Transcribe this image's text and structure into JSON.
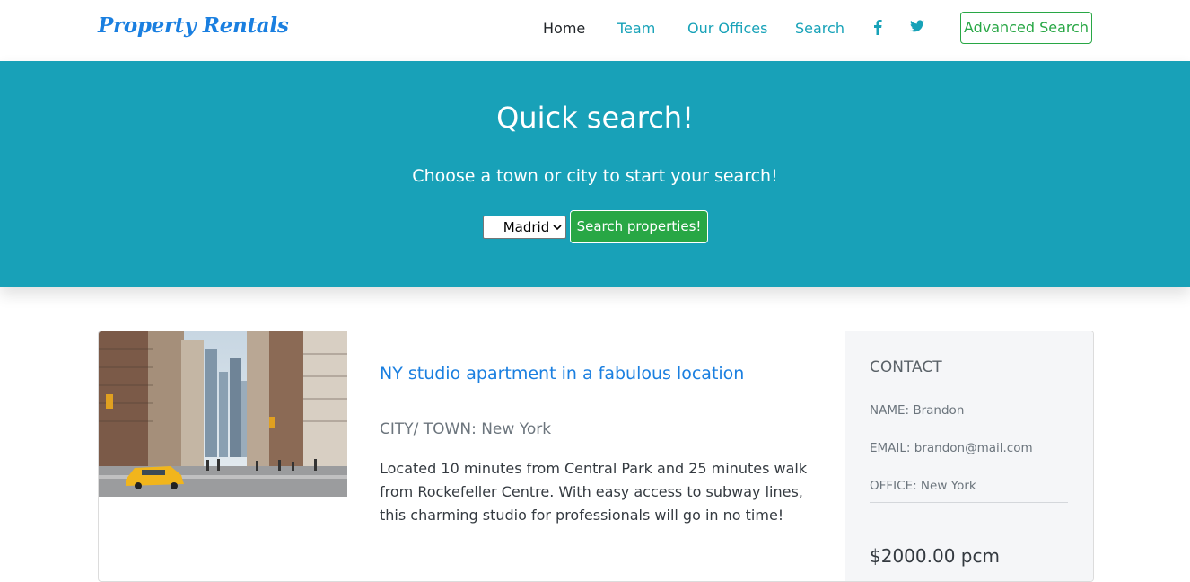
{
  "brand": "Property Rentals",
  "nav": {
    "home": "Home",
    "team": "Team",
    "offices": "Our Offices",
    "search": "Search",
    "advanced": "Advanced Search"
  },
  "social_icons": [
    "facebook-icon",
    "twitter-icon"
  ],
  "hero": {
    "title": "Quick search!",
    "subtitle": "Choose a town or city to start your search!",
    "selected_city": "Madrid",
    "button": "Search properties!"
  },
  "listing": {
    "title": "NY studio apartment in a fabulous location",
    "city": "CITY/ TOWN: New York",
    "description": "Located 10 minutes from Central Park and 25 minutes walk from Rockefeller Centre. With easy access to subway lines, this charming studio for professionals will go in no time!",
    "contact": {
      "heading": "CONTACT",
      "name": "NAME: Brandon",
      "email": "EMAIL: brandon@mail.com",
      "office": "OFFICE: New York",
      "price": "$2000.00 pcm"
    }
  },
  "colors": {
    "brand": "#1a7fe0",
    "hero_bg": "#18a1b8",
    "nav_link": "#17a2b8",
    "success": "#28a745"
  }
}
